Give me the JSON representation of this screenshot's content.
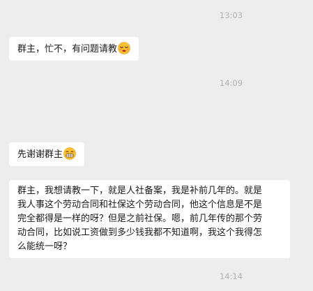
{
  "chat": {
    "timestamps": [
      "13:03",
      "14:09",
      "14:14"
    ],
    "messages": [
      {
        "text": "群主，忙不，有问题请教",
        "emoji": "sleepy-face-emoji"
      },
      {
        "text": "先谢谢群主",
        "emoji": "grinning-face-emoji"
      },
      {
        "lines": [
          "群主，我想请教一下，就是人社备案，我是补前几年的。就是",
          "我人事这个劳动合同和社保这个劳动合同，他这个信息是不是",
          "完全都得是一样的呀？但是之前社保。嗯，前几年传的那个劳",
          "动合同，比如说工资做到多少钱我都不知道啊，我这个我得怎",
          "么能统一呀？"
        ]
      }
    ]
  }
}
